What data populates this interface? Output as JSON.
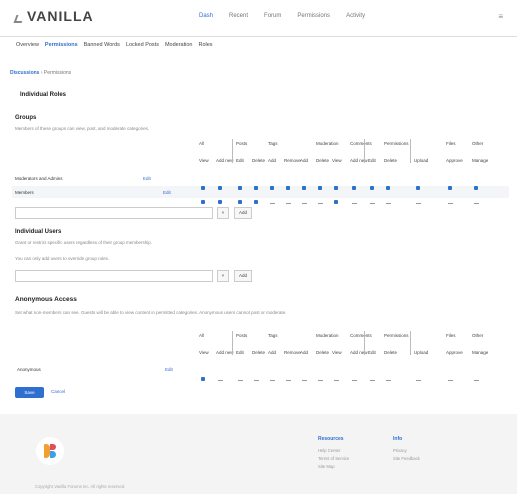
{
  "header": {
    "brand": "VANILLA",
    "nav": [
      "Dash",
      "Recent",
      "Forum",
      "Permissions",
      "Activity"
    ],
    "active_nav": 0,
    "menu_icon": "hamburger-icon"
  },
  "subnav": [
    "Overview",
    "Permissions",
    "Banned Words",
    "Locked Posts",
    "Moderation",
    "Roles"
  ],
  "active_subnav": 1,
  "breadcrumbs": [
    "Discussions",
    "Permissions"
  ],
  "page_title": "Individual Roles",
  "groups": {
    "title": "Groups",
    "desc": "Members of these groups can view, post, and moderate categories.",
    "column_groups": [
      "All",
      "Posts",
      "Tags",
      "Moderation",
      "Comments",
      "Permissions",
      "Files",
      "Other"
    ],
    "subheaders": [
      "View",
      "Add new",
      "Edit",
      "Delete",
      "Add",
      "Remove",
      "Add",
      "Delete",
      "View",
      "Add new",
      "Edit",
      "Delete",
      "Upload",
      "Approve",
      "Manage"
    ],
    "rows": [
      {
        "label": "Moderators and Admins",
        "edit": "Edit",
        "cells": [
          "check",
          "check",
          "check",
          "check",
          "check",
          "check",
          "check",
          "check",
          "check",
          "check",
          "check",
          "check",
          "check",
          "check",
          "check"
        ]
      },
      {
        "label": "Members",
        "edit": "Edit",
        "cells": [
          "check",
          "check",
          "check",
          "check",
          "dash",
          "dash",
          "dash",
          "dash",
          "check",
          "dash",
          "dash",
          "dash",
          "dash",
          "dash",
          "dash"
        ]
      }
    ],
    "add_label": "Add"
  },
  "individual": {
    "title": "Individual Users",
    "desc": "Grant or restrict specific users regardless of their group membership.",
    "note": "You can only add users to override group rules.",
    "add_label": "Add"
  },
  "anonymous": {
    "title": "Anonymous Access",
    "desc": "Set what non-members can see. Guests will be able to view content in permitted categories. Anonymous users cannot post or moderate.",
    "column_groups": [
      "All",
      "Posts",
      "Tags",
      "Moderation",
      "Comments",
      "Permissions",
      "Files",
      "Other"
    ],
    "subheaders": [
      "View",
      "Add new",
      "Edit",
      "Delete",
      "Add",
      "Remove",
      "Add",
      "Delete",
      "View",
      "Add new",
      "Edit",
      "Delete",
      "Upload",
      "Approve",
      "Manage"
    ],
    "row": {
      "label": "Anonymous",
      "edit": "Edit",
      "cells": [
        "check",
        "dash",
        "dash",
        "dash",
        "dash",
        "dash",
        "dash",
        "dash",
        "dash",
        "dash",
        "dash",
        "dash",
        "dash",
        "dash",
        "dash"
      ]
    }
  },
  "actions": {
    "save": "Save",
    "cancel": "Cancel"
  },
  "footer": {
    "col1_title": "Resources",
    "col1_links": [
      "Help Center",
      "Terms of Service",
      "Site Map"
    ],
    "col2_title": "Info",
    "col2_links": [
      "Privacy",
      "Site Feedback"
    ],
    "copyright": "Copyright Vanilla Forums Inc. All rights reserved."
  },
  "colors": {
    "accent": "#2f6fd0",
    "footer_bg": "#f4f4f4"
  }
}
